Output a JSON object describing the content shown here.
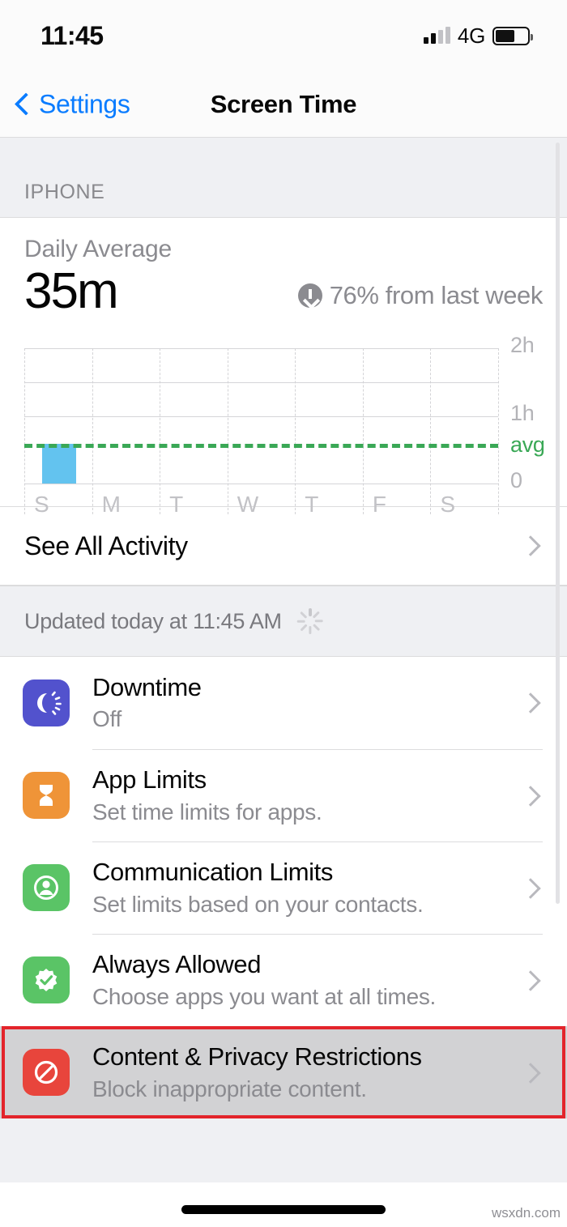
{
  "status_bar": {
    "time": "11:45",
    "network": "4G",
    "signal_icon": "cellular-signal-icon",
    "battery_icon": "battery-icon",
    "battery_level_percent": 60
  },
  "nav": {
    "back_label": "Settings",
    "back_icon": "chevron-left-icon",
    "title": "Screen Time"
  },
  "section": {
    "header": "IPHONE"
  },
  "summary": {
    "label": "Daily Average",
    "value": "35m",
    "delta_icon": "arrow-down-circle-icon",
    "delta_text": "76% from last week"
  },
  "chart_data": {
    "type": "bar",
    "title": "Daily Average",
    "categories": [
      "S",
      "M",
      "T",
      "W",
      "T",
      "F",
      "S"
    ],
    "values": [
      35,
      0,
      0,
      0,
      0,
      0,
      0
    ],
    "unit": "minutes",
    "ylabel": "",
    "xlabel": "",
    "ylim": [
      0,
      120
    ],
    "ytick_values": [
      0,
      60,
      120
    ],
    "ytick_labels": [
      "0",
      "1h",
      "2h"
    ],
    "average_line": {
      "label": "avg",
      "value": 35,
      "color": "#3aa856",
      "style": "dashed"
    },
    "bar_color": "#63c3ef",
    "grid": true,
    "legend": "none"
  },
  "see_all": {
    "label": "See All Activity",
    "chevron_icon": "chevron-right-icon"
  },
  "updated": {
    "text": "Updated today at 11:45 AM",
    "spinner_icon": "activity-spinner-icon"
  },
  "settings_rows": [
    {
      "title": "Downtime",
      "subtitle": "Off",
      "icon_name": "downtime-bedtime-icon",
      "icon_color": "#5252cd",
      "chevron_icon": "chevron-right-icon",
      "highlighted": false
    },
    {
      "title": "App Limits",
      "subtitle": "Set time limits for apps.",
      "icon_name": "hourglass-icon",
      "icon_color": "#ef9438",
      "chevron_icon": "chevron-right-icon",
      "highlighted": false
    },
    {
      "title": "Communication Limits",
      "subtitle": "Set limits based on your contacts.",
      "icon_name": "person-circle-icon",
      "icon_color": "#5ac466",
      "chevron_icon": "chevron-right-icon",
      "highlighted": false
    },
    {
      "title": "Always Allowed",
      "subtitle": "Choose apps you want at all times.",
      "icon_name": "checkmark-seal-icon",
      "icon_color": "#5ac466",
      "chevron_icon": "chevron-right-icon",
      "highlighted": false
    },
    {
      "title": "Content & Privacy Restrictions",
      "subtitle": "Block inappropriate content.",
      "icon_name": "prohibited-sign-icon",
      "icon_color": "#e8453c",
      "chevron_icon": "chevron-right-icon",
      "highlighted": true
    }
  ],
  "annotation": {
    "highlight_color": "#e3242b"
  },
  "watermark": {
    "text": "wsxdn.com"
  },
  "home_indicator_icon": "home-indicator-bar"
}
